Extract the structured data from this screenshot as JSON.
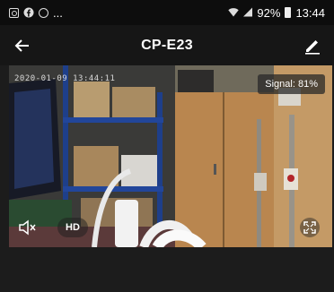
{
  "status_bar": {
    "left_icons": [
      "screenshot-icon",
      "facebook-icon",
      "sync-icon"
    ],
    "ellipsis": "...",
    "battery": "92%",
    "time": "13:44"
  },
  "app_bar": {
    "back_icon": "back-arrow-icon",
    "title": "CP-E23",
    "edit_icon": "pencil-icon"
  },
  "video": {
    "timestamp": "2020-01-09 13:44:11",
    "signal": "Signal: 81%",
    "controls": {
      "mute_icon": "speaker-mute-icon",
      "quality": "HD",
      "fullscreen_icon": "fullscreen-icon"
    }
  }
}
